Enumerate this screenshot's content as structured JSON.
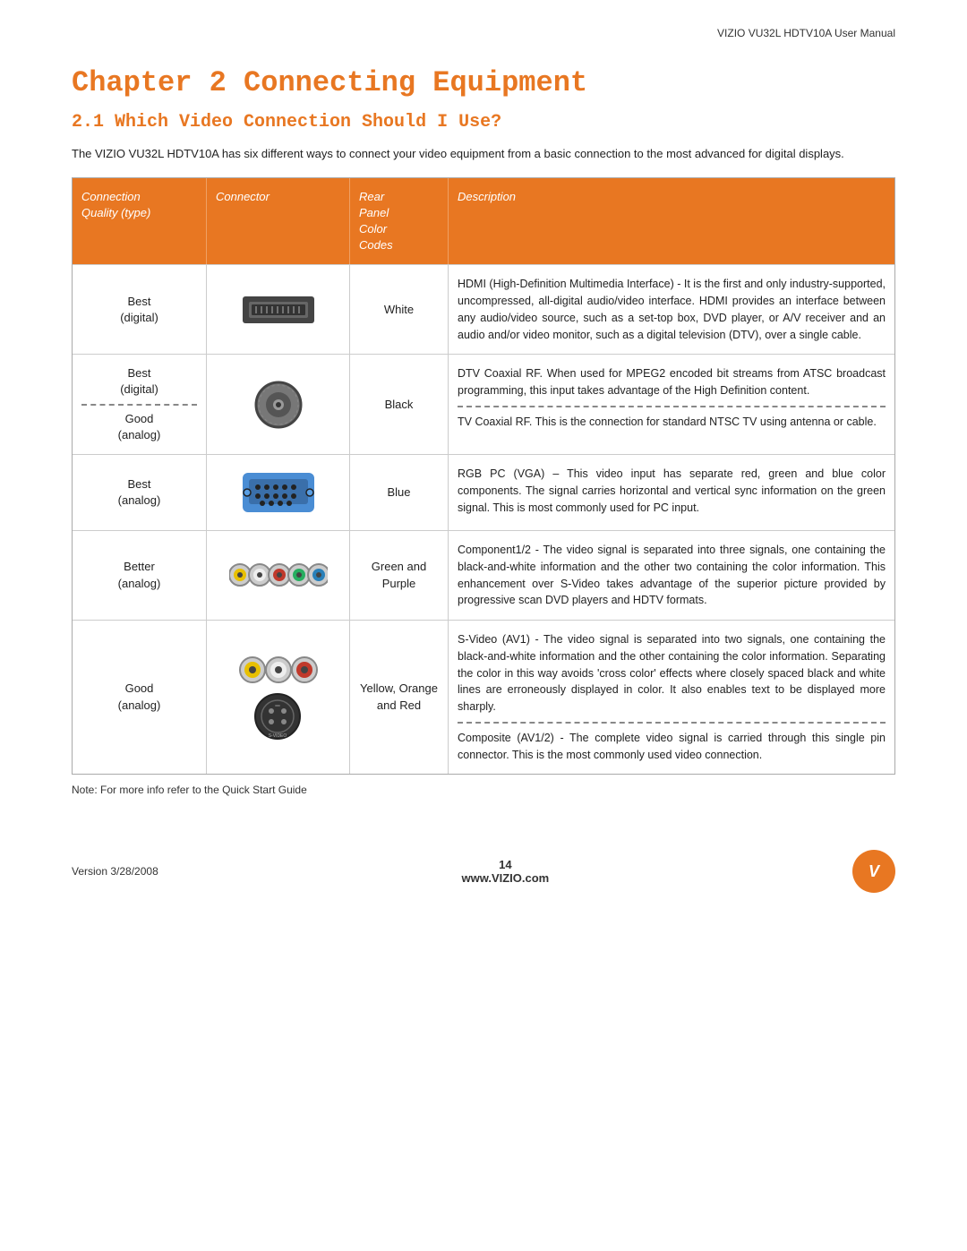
{
  "header": {
    "manual_title": "VIZIO VU32L HDTV10A User Manual"
  },
  "chapter": {
    "title": "Chapter 2  Connecting Equipment",
    "section": "2.1 Which Video Connection Should I Use?",
    "intro": "The VIZIO VU32L HDTV10A has six different ways to connect your video equipment from a basic connection to the most advanced for digital displays."
  },
  "table": {
    "headers": {
      "col1": "Connection\nQuality (type)",
      "col2": "Connector",
      "col3": "Rear\nPanel\nColor\nCodes",
      "col4": "Description"
    },
    "rows": [
      {
        "quality": "Best\n(digital)",
        "color": "White",
        "description": "HDMI (High-Definition Multimedia Interface) - It is the first and only industry-supported, uncompressed, all-digital audio/video interface. HDMI provides an interface between any audio/video source, such as a set-top box, DVD player, or A/V receiver and an audio and/or video monitor, such as a digital television (DTV), over a single cable."
      },
      {
        "quality1": "Best\n(digital)",
        "quality2": "Good\n(analog)",
        "color": "Black",
        "description1": "DTV Coaxial RF.  When used for MPEG2 encoded bit streams from ATSC broadcast programming, this input takes advantage of the High Definition content.",
        "description2": "TV Coaxial RF. This is the connection for standard NTSC TV using antenna or cable."
      },
      {
        "quality": "Best\n(analog)",
        "color": "Blue",
        "description": "RGB PC (VGA) – This video input has separate red, green and blue color components.   The signal carries horizontal and vertical sync information on the green signal.  This is most commonly used for PC input."
      },
      {
        "quality": "Better\n(analog)",
        "color": "Green\nand\nPurple",
        "description": "Component1/2 - The video signal is separated into three signals, one containing the black-and-white information and the other two containing the color information. This enhancement over S-Video takes advantage of the superior picture provided by progressive scan DVD players and HDTV formats."
      },
      {
        "quality": "Good\n(analog)",
        "color": "Yellow,\nOrange\nand\nRed",
        "description1": "S-Video (AV1) - The video signal is separated into two signals, one containing the black-and-white information and the other containing the color information. Separating the color in this way avoids 'cross color' effects where closely spaced black and white lines are erroneously displayed in color. It also enables text to be displayed more sharply.",
        "description2": "Composite (AV1/2) - The complete video signal is carried through this single pin connector. This is the most commonly used video connection."
      }
    ]
  },
  "note": "Note:  For more info refer to the Quick Start Guide",
  "footer": {
    "version": "Version 3/28/2008",
    "page_number": "14",
    "website": "www.VIZIO.com"
  }
}
